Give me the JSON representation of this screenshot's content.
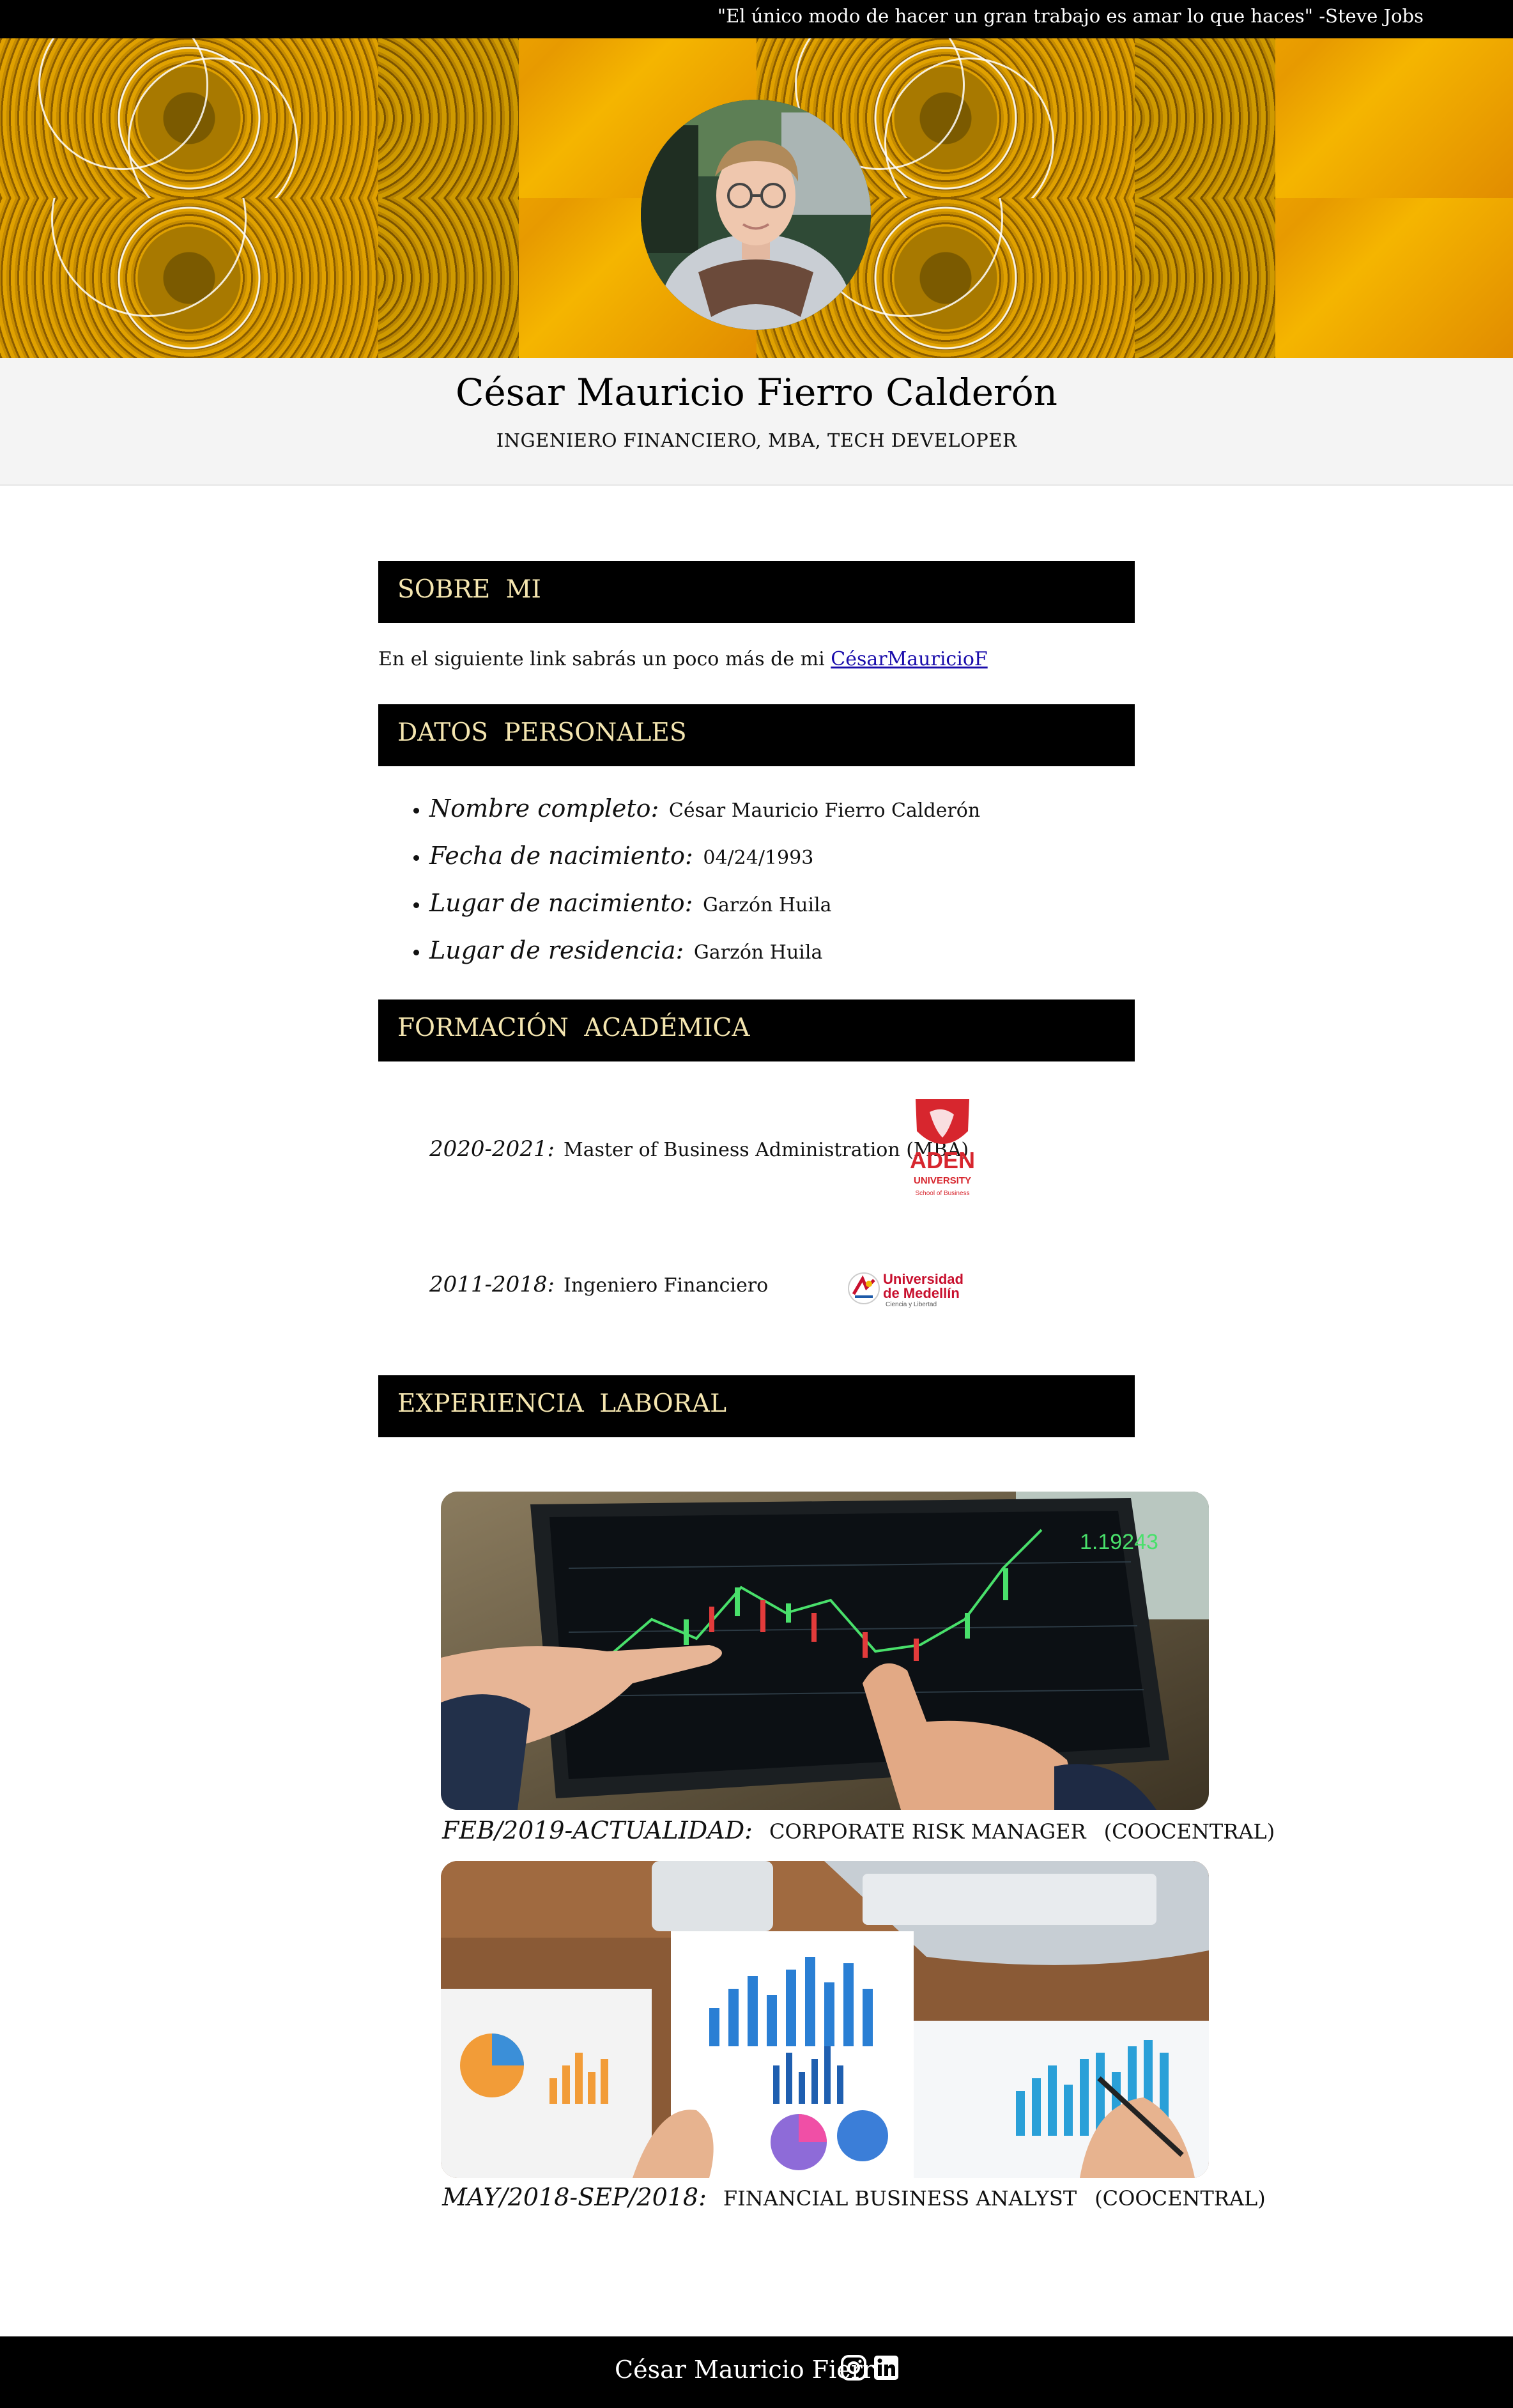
{
  "header": {
    "quote": "\"El único modo de hacer un gran trabajo es amar lo que haces\" -Steve Jobs"
  },
  "profile": {
    "name": "César Mauricio Fierro Calderón",
    "subtitle": "INGENIERO FINANCIERO, MBA, TECH DEVELOPER"
  },
  "about": {
    "title": "SOBRE MI",
    "text": "En el siguiente link sabrás un poco más de mi ",
    "link_label": "CésarMauricioF"
  },
  "personal": {
    "title": "DATOS PERSONALES",
    "items": [
      {
        "label": "Nombre completo:",
        "value": "César Mauricio Fierro Calderón"
      },
      {
        "label": "Fecha de nacimiento:",
        "value": "04/24/1993"
      },
      {
        "label": "Lugar de nacimiento:",
        "value": "Garzón Huila"
      },
      {
        "label": "Lugar de residencia:",
        "value": "Garzón Huila"
      }
    ]
  },
  "education": {
    "title": "FORMACIÓN ACADÉMICA",
    "items": [
      {
        "years": "2020-2021:",
        "degree": "Master of Business Administration (MBA)",
        "logo_text": [
          "ADEN",
          "UNIVERSITY",
          "School of Business"
        ]
      },
      {
        "years": "2011-2018:",
        "degree": "Ingeniero Financiero",
        "logo_text": [
          "Universidad",
          "de Medellín",
          "Ciencia y Libertad"
        ]
      }
    ]
  },
  "experience": {
    "title": "EXPERIENCIA LABORAL",
    "items": [
      {
        "period": "FEB/2019-ACTUALIDAD:",
        "role": "CORPORATE RISK MANAGER",
        "company": "(COOCENTRAL)"
      },
      {
        "period": "MAY/2018-SEP/2018:",
        "role": "FINANCIAL BUSINESS ANALYST",
        "company": "(COOCENTRAL)"
      }
    ]
  },
  "footer": {
    "name": "César Mauricio Fierro"
  },
  "colors": {
    "section_bg": "#000000",
    "section_text": "#f5e6b0",
    "link": "#1a0dab",
    "banner": "#e39a00"
  }
}
